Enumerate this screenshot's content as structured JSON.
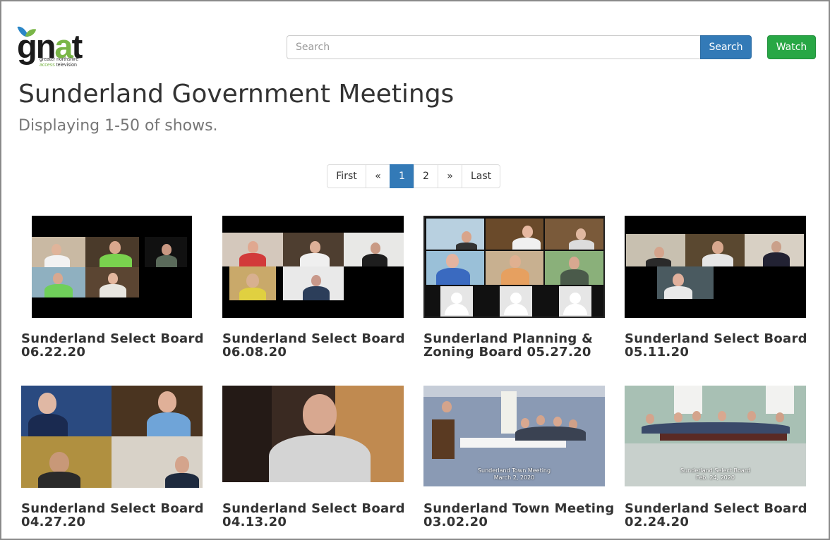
{
  "brand": {
    "logo_word": "gnat",
    "tagline_1": "greater northshire",
    "tagline_2a": "access",
    "tagline_2b": " television"
  },
  "search": {
    "placeholder": "Search",
    "button_label": "Search"
  },
  "watch_label": "Watch",
  "page": {
    "title": "Sunderland Government Meetings",
    "subtitle": "Displaying 1-50 of shows."
  },
  "pagination": {
    "first": "First",
    "prev": "«",
    "pages": [
      "1",
      "2"
    ],
    "next": "»",
    "last": "Last",
    "current": "1"
  },
  "colors": {
    "primary": "#337ab7",
    "success": "#28a745",
    "logo_green": "#7ab648",
    "logo_blue": "#2a86c7"
  },
  "shows": [
    {
      "title": "Sunderland Select Board 06.22.20"
    },
    {
      "title": "Sunderland Select Board 06.08.20"
    },
    {
      "title": "Sunderland Planning & Zoning Board 05.27.20"
    },
    {
      "title": "Sunderland Select Board 05.11.20"
    },
    {
      "title": "Sunderland Select Board 04.27.20"
    },
    {
      "title": "Sunderland Select Board 04.13.20"
    },
    {
      "title": "Sunderland Town Meeting 03.02.20",
      "caption_1": "Sunderland Town Meeting",
      "caption_2": "March 2, 2020"
    },
    {
      "title": "Sunderland Select Board 02.24.20",
      "caption_1": "Sunderland Select Board",
      "caption_2": "Feb. 24, 2020"
    }
  ]
}
